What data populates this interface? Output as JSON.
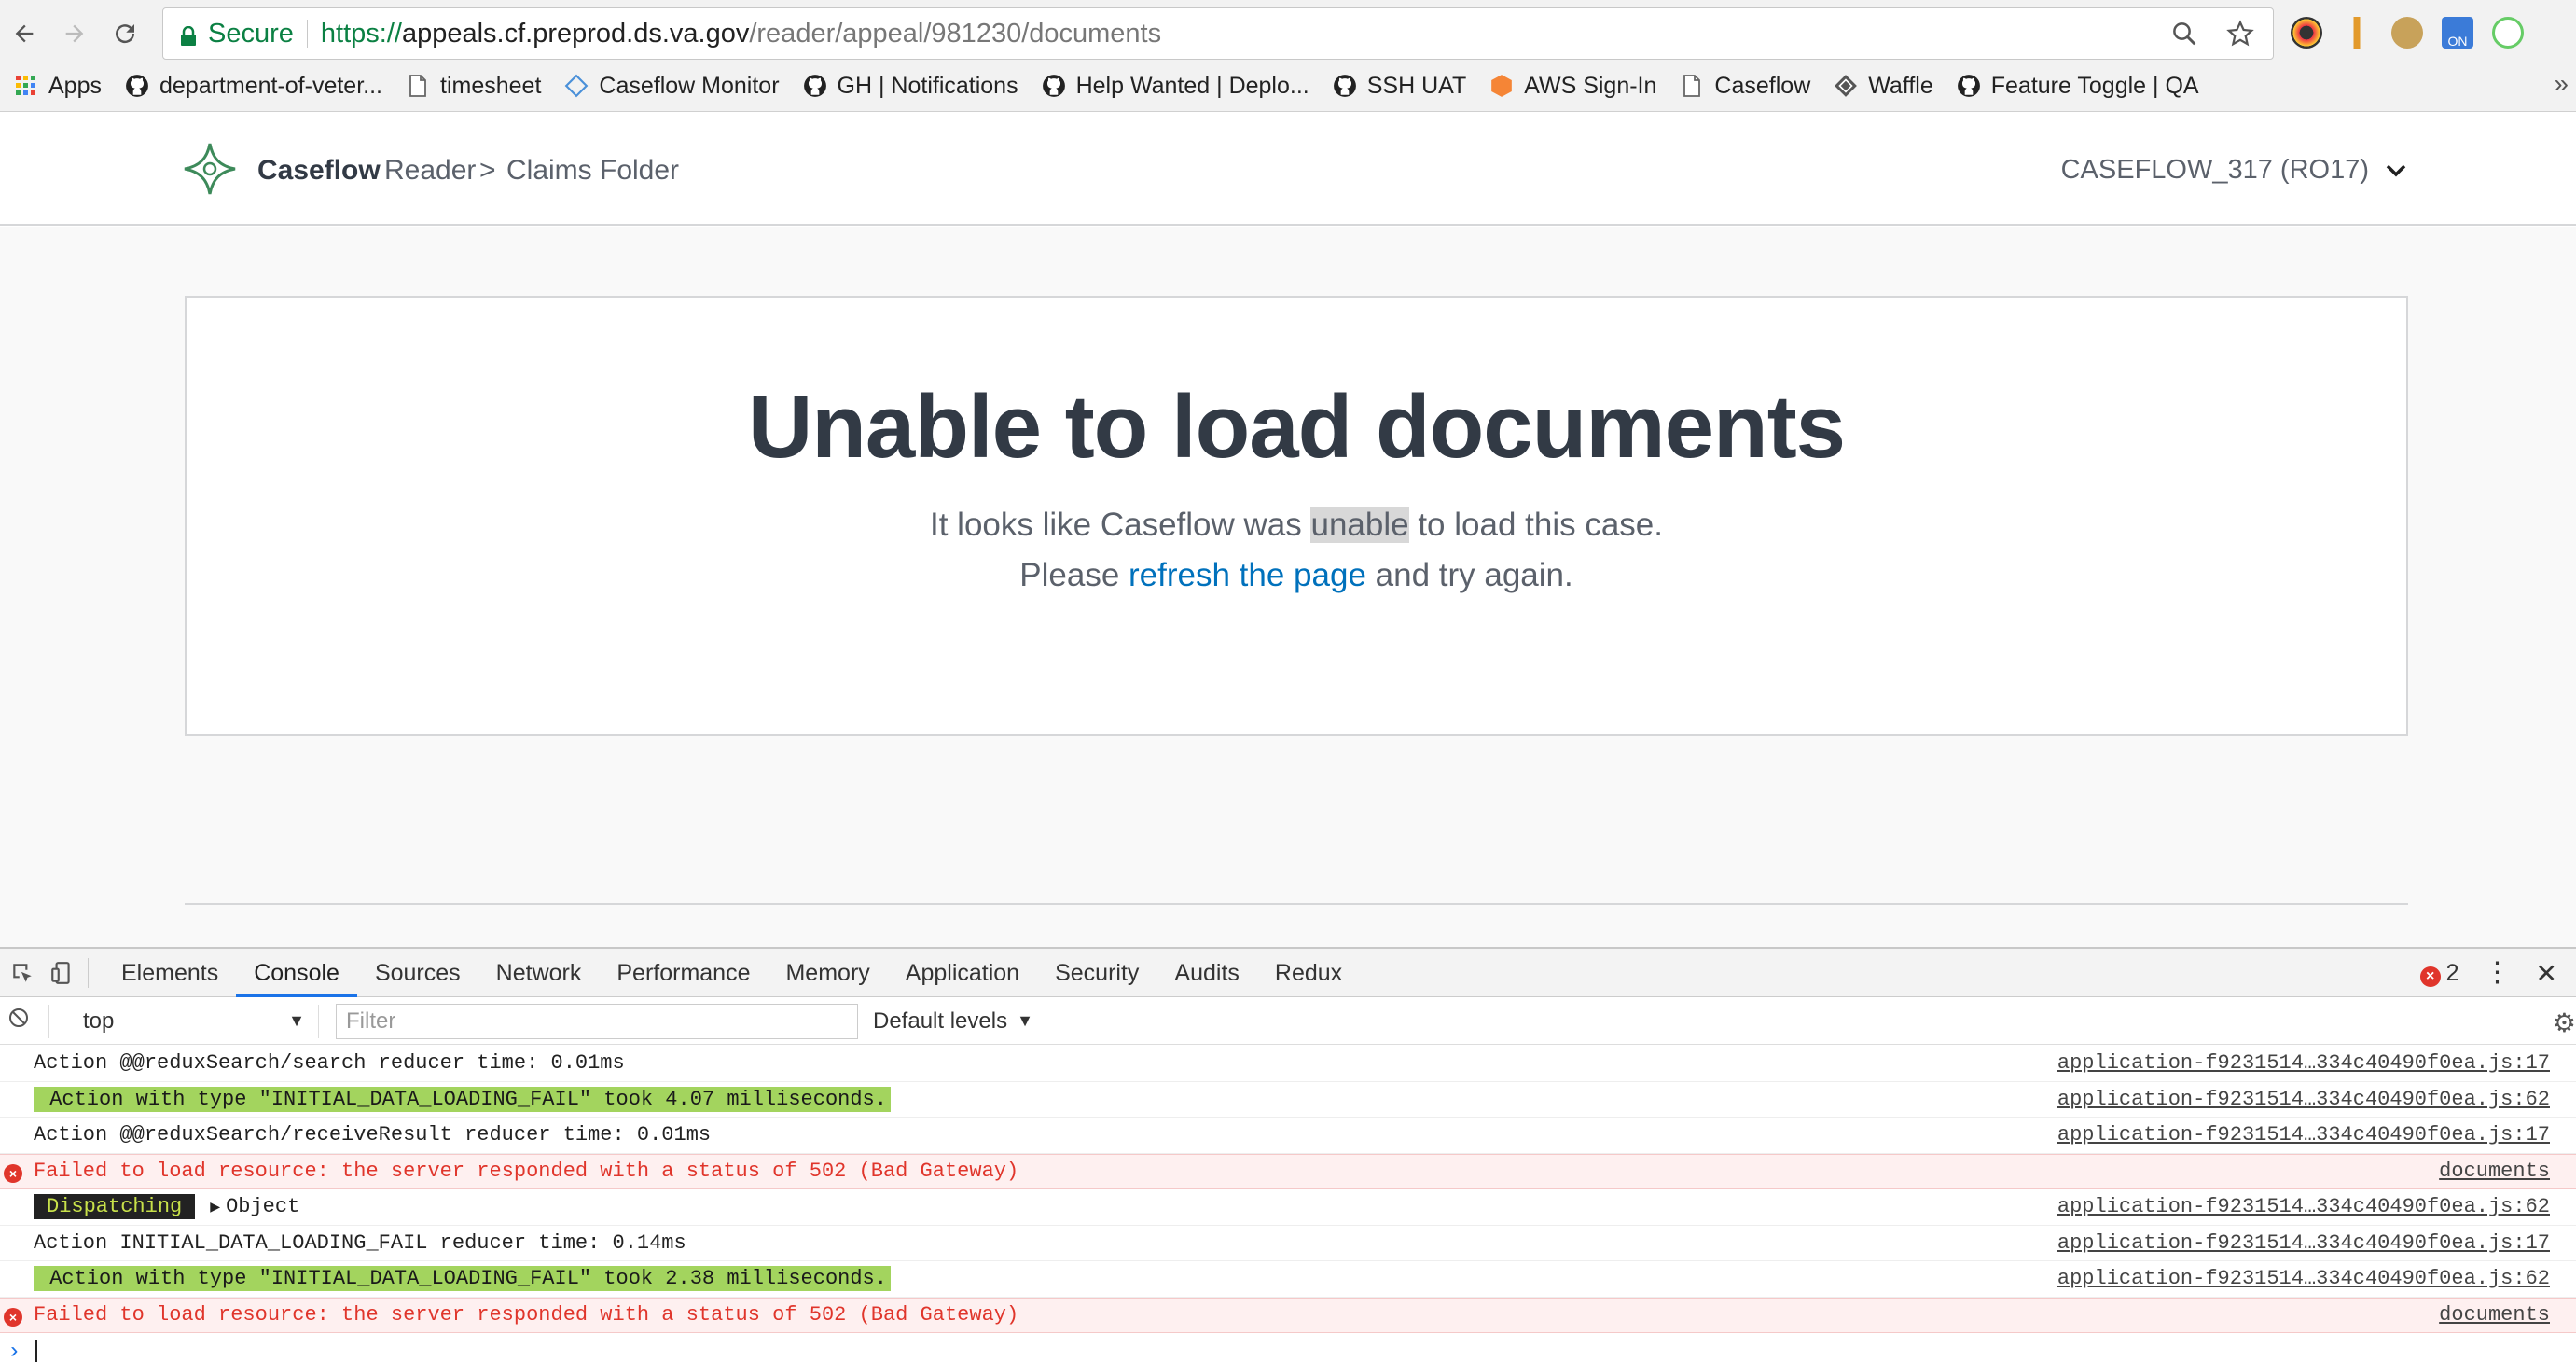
{
  "browser": {
    "secure_label": "Secure",
    "url_scheme": "https://",
    "url_host": "appeals.cf.preprod.ds.va.gov",
    "url_path": "/reader/appeal/981230/documents",
    "bookmarks": [
      {
        "label": "Apps",
        "icon": "apps-grid-icon"
      },
      {
        "label": "department-of-veter...",
        "icon": "github-icon"
      },
      {
        "label": "timesheet",
        "icon": "page-icon"
      },
      {
        "label": "Caseflow Monitor",
        "icon": "diamond-icon"
      },
      {
        "label": "GH | Notifications",
        "icon": "github-icon"
      },
      {
        "label": "Help Wanted | Deplo...",
        "icon": "github-icon"
      },
      {
        "label": "SSH UAT",
        "icon": "github-icon"
      },
      {
        "label": "AWS Sign-In",
        "icon": "aws-icon"
      },
      {
        "label": "Caseflow",
        "icon": "page-icon"
      },
      {
        "label": "Waffle",
        "icon": "waffle-icon"
      },
      {
        "label": "Feature Toggle | QA",
        "icon": "github-icon"
      }
    ],
    "bookmarks_more": "»"
  },
  "app": {
    "brand": "Caseflow",
    "breadcrumb_1": "Reader",
    "breadcrumb_sep": ">",
    "breadcrumb_2": "Claims Folder",
    "user": "CASEFLOW_317 (RO17)"
  },
  "error_card": {
    "title": "Unable to load documents",
    "line1_before": "It looks like Caseflow was ",
    "line1_highlight": "unable",
    "line1_after": " to load this case.",
    "line2_before": "Please ",
    "line2_link": "refresh the page",
    "line2_after": " and try again."
  },
  "devtools": {
    "tabs": [
      "Elements",
      "Console",
      "Sources",
      "Network",
      "Performance",
      "Memory",
      "Application",
      "Security",
      "Audits",
      "Redux"
    ],
    "active_tab": "Console",
    "error_count": "2",
    "context": "top",
    "filter_placeholder": "Filter",
    "levels": "Default levels",
    "logs": [
      {
        "type": "log",
        "text": "Action @@reduxSearch/search reducer time: 0.01ms",
        "source": "application-f9231514…334c40490f0ea.js:17"
      },
      {
        "type": "green",
        "text": " Action with type \"INITIAL_DATA_LOADING_FAIL\" took 4.07 milliseconds.",
        "source": "application-f9231514…334c40490f0ea.js:62"
      },
      {
        "type": "log",
        "text": "Action @@reduxSearch/receiveResult reducer time: 0.01ms",
        "source": "application-f9231514…334c40490f0ea.js:17"
      },
      {
        "type": "error",
        "text": "Failed to load resource: the server responded with a status of 502 (Bad Gateway)",
        "source": "documents"
      },
      {
        "type": "dispatch",
        "badge": " Dispatching ",
        "text": "Object",
        "source": "application-f9231514…334c40490f0ea.js:62"
      },
      {
        "type": "log",
        "text": "Action INITIAL_DATA_LOADING_FAIL reducer time: 0.14ms",
        "source": "application-f9231514…334c40490f0ea.js:17"
      },
      {
        "type": "green",
        "text": " Action with type \"INITIAL_DATA_LOADING_FAIL\" took 2.38 milliseconds.",
        "source": "application-f9231514…334c40490f0ea.js:62"
      },
      {
        "type": "error",
        "text": "Failed to load resource: the server responded with a status of 502 (Bad Gateway)",
        "source": "documents"
      }
    ]
  }
}
